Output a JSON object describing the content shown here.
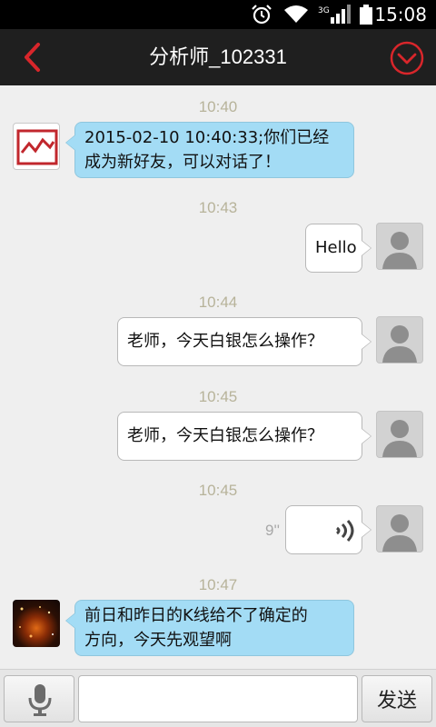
{
  "status_bar": {
    "time": "15:08",
    "network": "3G",
    "icons": [
      "alarm-icon",
      "wifi-icon",
      "signal-icon",
      "battery-icon"
    ]
  },
  "header": {
    "title": "分析师_102331",
    "back_icon": "chevron-left-icon",
    "menu_icon": "chevron-down-circle-icon",
    "accent_color": "#d8262b"
  },
  "messages": [
    {
      "time": "10:40",
      "direction": "in",
      "avatar": "chart-logo-avatar",
      "lines": [
        "2015-02-10 10:40:33;你们已经",
        "成为新好友，可以对话了！"
      ]
    },
    {
      "time": "10:43",
      "direction": "out",
      "avatar": "default-user-avatar",
      "lines": [
        "Hello"
      ]
    },
    {
      "time": "10:44",
      "direction": "out",
      "avatar": "default-user-avatar",
      "lines": [
        "老师，今天白银怎么操作？"
      ]
    },
    {
      "time": "10:45",
      "direction": "out",
      "avatar": "default-user-avatar",
      "lines": [
        "老师，今天白银怎么操作？"
      ]
    },
    {
      "time": "10:45",
      "direction": "out",
      "avatar": "default-user-avatar",
      "type": "voice",
      "duration": "9''"
    },
    {
      "time": "10:47",
      "direction": "in",
      "avatar": "galaxy-photo-avatar",
      "lines": [
        "前日和昨日的K线给不了确定的",
        "方向，今天先观望啊"
      ]
    }
  ],
  "input_bar": {
    "mic_icon": "microphone-icon",
    "placeholder": "",
    "send_label": "发送"
  },
  "colors": {
    "incoming_bubble": "#a3dcf5",
    "outgoing_bubble": "#ffffff",
    "timestamp": "#b7b39a"
  }
}
